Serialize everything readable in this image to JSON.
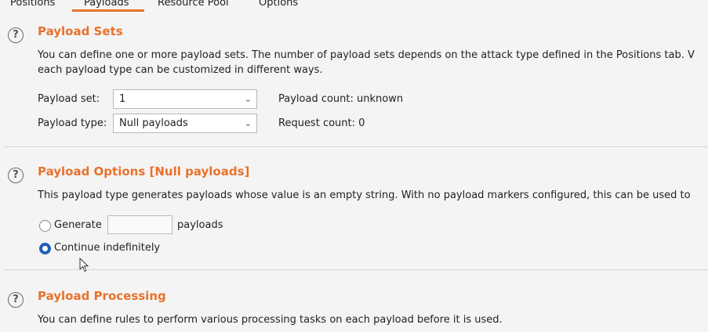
{
  "tabs": [
    {
      "label": "Positions"
    },
    {
      "label": "Payloads",
      "active": true
    },
    {
      "label": "Resource Pool"
    },
    {
      "label": "Options"
    }
  ],
  "payload_sets": {
    "title": "Payload Sets",
    "description_line1": "You can define one or more payload sets. The number of payload sets depends on the attack type defined in the Positions tab. V",
    "description_line2": "each payload type can be customized in different ways.",
    "payload_set_label": "Payload set:",
    "payload_set_value": "1",
    "payload_type_label": "Payload type:",
    "payload_type_value": "Null payloads",
    "payload_count": "Payload count: unknown",
    "request_count": "Request count: 0"
  },
  "payload_options": {
    "title": "Payload Options [Null payloads]",
    "description": "This payload type generates payloads whose value is an empty string. With no payload markers configured, this can be used to",
    "generate_label": "Generate",
    "generate_value": "",
    "payloads_suffix": "payloads",
    "continue_label": "Continue indefinitely",
    "selected_option": "continue"
  },
  "payload_processing": {
    "title": "Payload Processing",
    "description": "You can define rules to perform various processing tasks on each payload before it is used."
  },
  "icons": {
    "help": "?",
    "dropdown": "chevron-down-icon",
    "cursor": "mouse-pointer-icon"
  },
  "colors": {
    "accent": "#e8722c",
    "radio_selected": "#1f5fb8",
    "background": "#f4f4f4"
  }
}
